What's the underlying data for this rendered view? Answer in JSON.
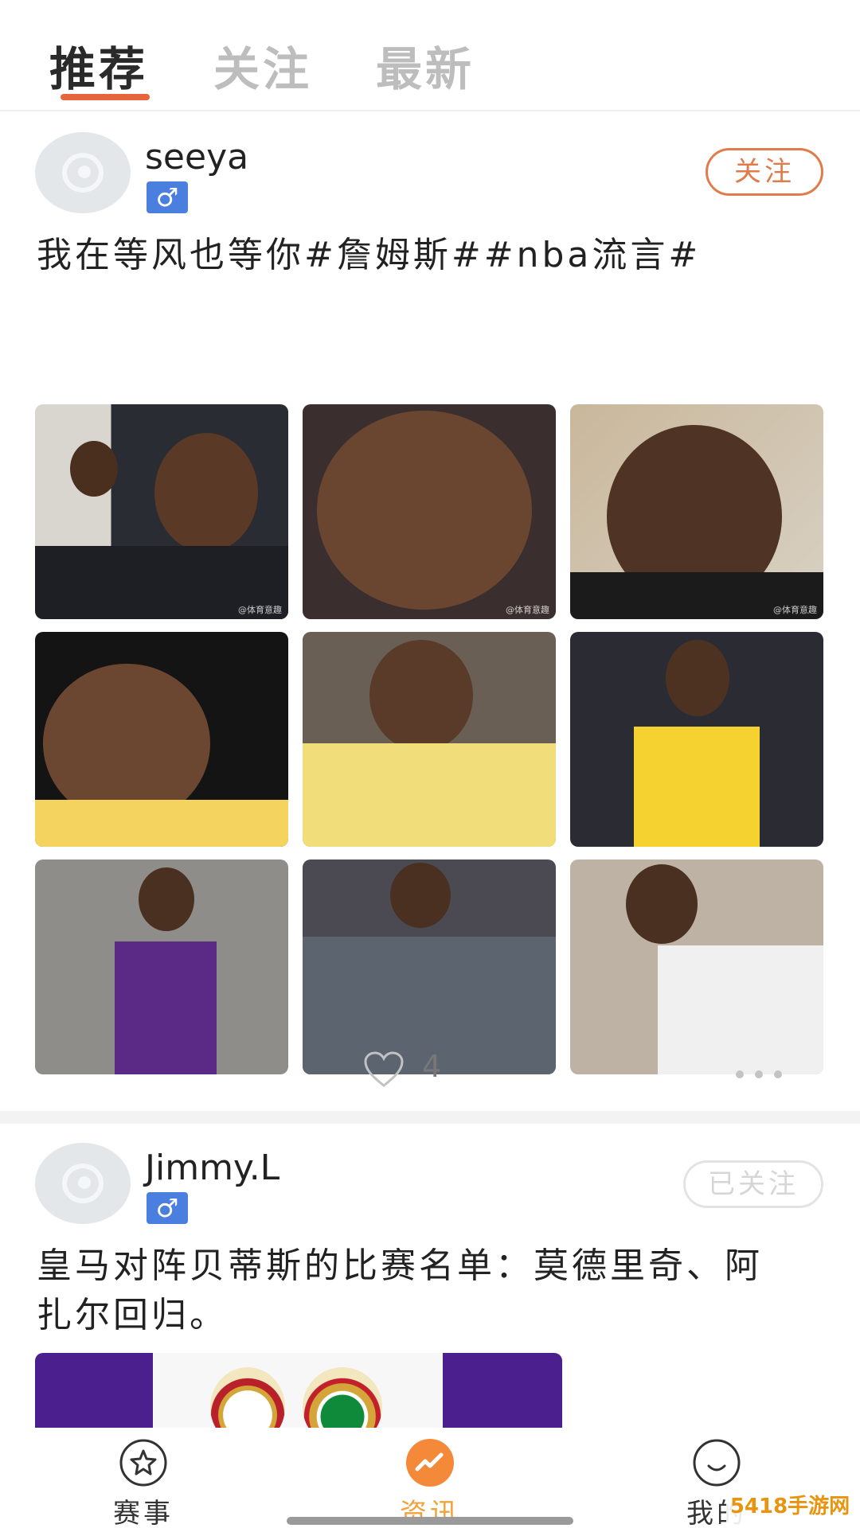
{
  "tabs": [
    {
      "label": "推荐",
      "active": true
    },
    {
      "label": "关注",
      "active": false
    },
    {
      "label": "最新",
      "active": false
    }
  ],
  "posts": [
    {
      "username": "seeya",
      "gender_symbol": "♂",
      "follow_label": "关注",
      "text": "我在等风也等你#詹姆斯##nba流言#",
      "likes": "4",
      "photos": [
        {
          "wm": "@体育意趣"
        },
        {
          "wm": "@体育意趣"
        },
        {
          "wm": "@体育意趣"
        },
        {
          "wm": ""
        },
        {
          "wm": ""
        },
        {
          "wm": ""
        },
        {
          "wm": ""
        },
        {
          "wm": ""
        },
        {
          "wm": ""
        }
      ]
    },
    {
      "username": "Jimmy.L",
      "gender_symbol": "♂",
      "follow_label": "已关注",
      "text": "皇马对阵贝蒂斯的比赛名单：莫德里奇、阿扎尔回归。"
    }
  ],
  "bottom_nav": [
    {
      "label": "赛事",
      "icon": "star-icon",
      "active": false
    },
    {
      "label": "资讯",
      "icon": "trend-icon",
      "active": true
    },
    {
      "label": "我的",
      "icon": "smile-icon",
      "active": false
    }
  ],
  "watermark": "5418手游网",
  "colors": {
    "accent": "#e8643a",
    "follow": "#e07b4c",
    "nav_active": "#f1a33b",
    "gender": "#4a7fe0"
  }
}
